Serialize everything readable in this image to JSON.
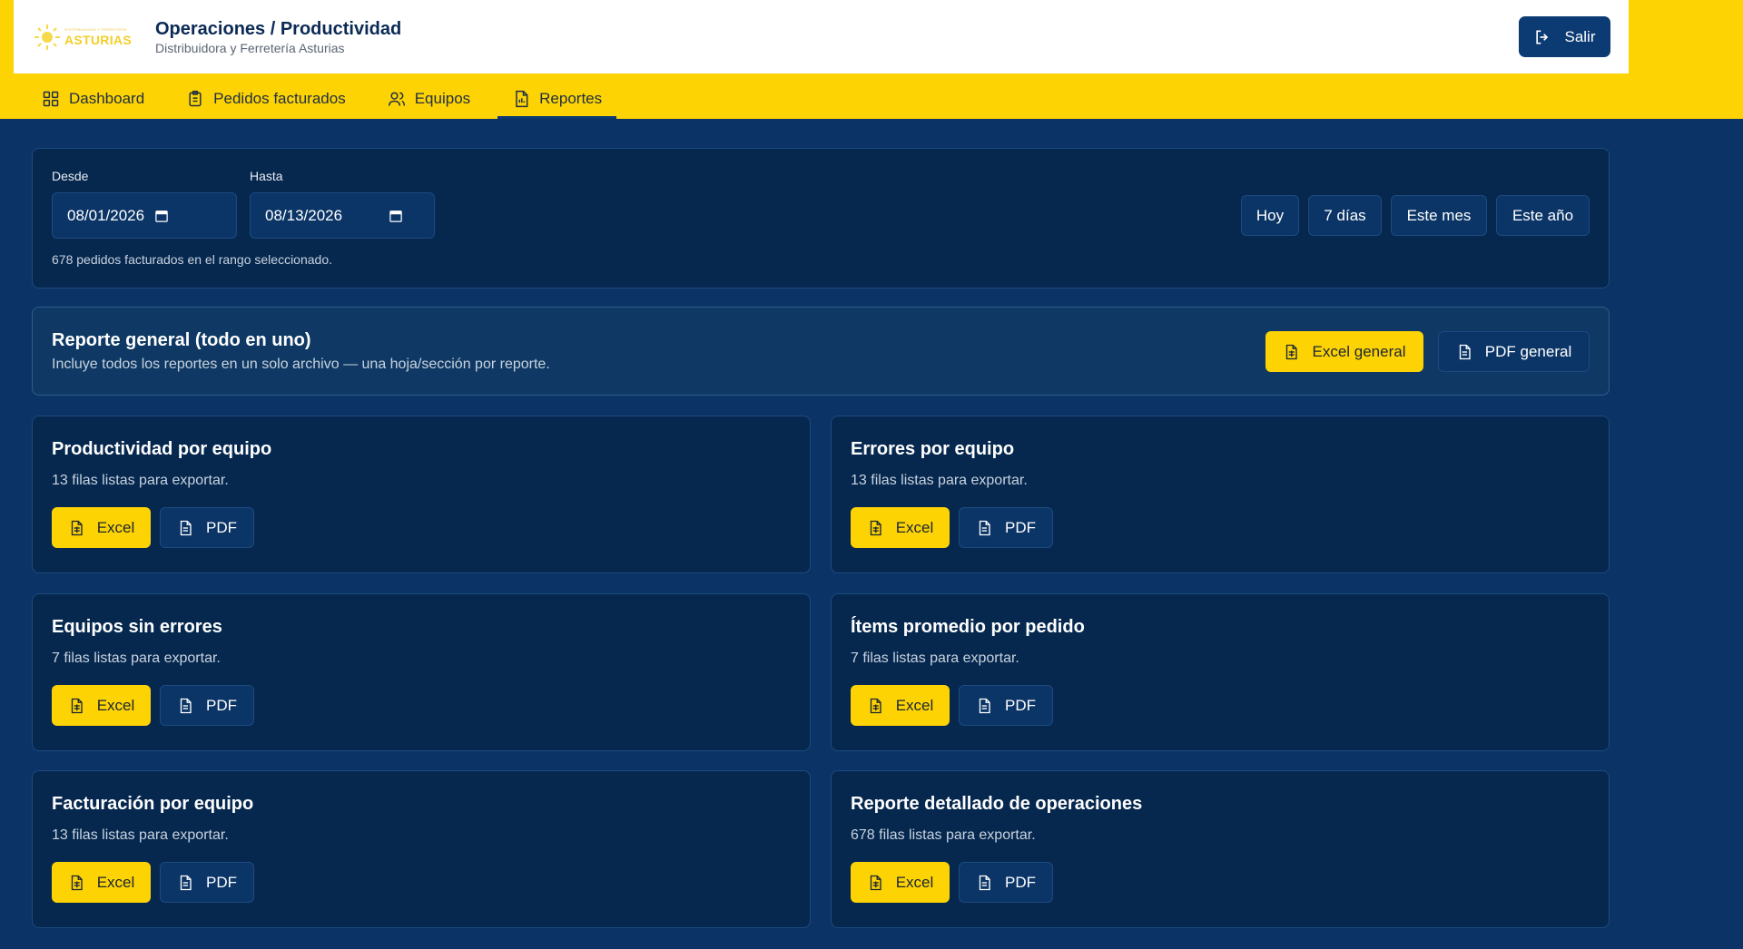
{
  "header": {
    "logo_text": "ASTURIAS",
    "logo_tagline": "DISTRIBUIDORA Y FERRETERÍA",
    "title": "Operaciones / Productividad",
    "subtitle": "Distribuidora y Ferretería Asturias",
    "logout_label": "Salir"
  },
  "nav": {
    "items": [
      {
        "label": "Dashboard",
        "icon": "dashboard-icon"
      },
      {
        "label": "Pedidos facturados",
        "icon": "clipboard-icon"
      },
      {
        "label": "Equipos",
        "icon": "users-icon"
      },
      {
        "label": "Reportes",
        "icon": "report-icon",
        "active": true
      }
    ]
  },
  "filters": {
    "from_label": "Desde",
    "from_value": "08/01/2026",
    "to_label": "Hasta",
    "to_value": "08/13/2026",
    "quick": [
      "Hoy",
      "7 días",
      "Este mes",
      "Este año"
    ],
    "count_text": "678 pedidos facturados en el rango seleccionado."
  },
  "general": {
    "title": "Reporte general (todo en uno)",
    "description": "Incluye todos los reportes en un solo archivo — una hoja/sección por reporte.",
    "excel_label": "Excel general",
    "pdf_label": "PDF general"
  },
  "reports": [
    {
      "title": "Productividad por equipo",
      "rows": "13 filas listas para exportar.",
      "excel": "Excel",
      "pdf": "PDF"
    },
    {
      "title": "Errores por equipo",
      "rows": "13 filas listas para exportar.",
      "excel": "Excel",
      "pdf": "PDF"
    },
    {
      "title": "Equipos sin errores",
      "rows": "7 filas listas para exportar.",
      "excel": "Excel",
      "pdf": "PDF"
    },
    {
      "title": "Ítems promedio por pedido",
      "rows": "7 filas listas para exportar.",
      "excel": "Excel",
      "pdf": "PDF"
    },
    {
      "title": "Facturación por equipo",
      "rows": "13 filas listas para exportar.",
      "excel": "Excel",
      "pdf": "PDF"
    },
    {
      "title": "Reporte detallado de operaciones",
      "rows": "678 filas listas para exportar.",
      "excel": "Excel",
      "pdf": "PDF"
    }
  ],
  "colors": {
    "accent": "#fdd304",
    "primary": "#0c3a73",
    "background": "#0b3366"
  }
}
